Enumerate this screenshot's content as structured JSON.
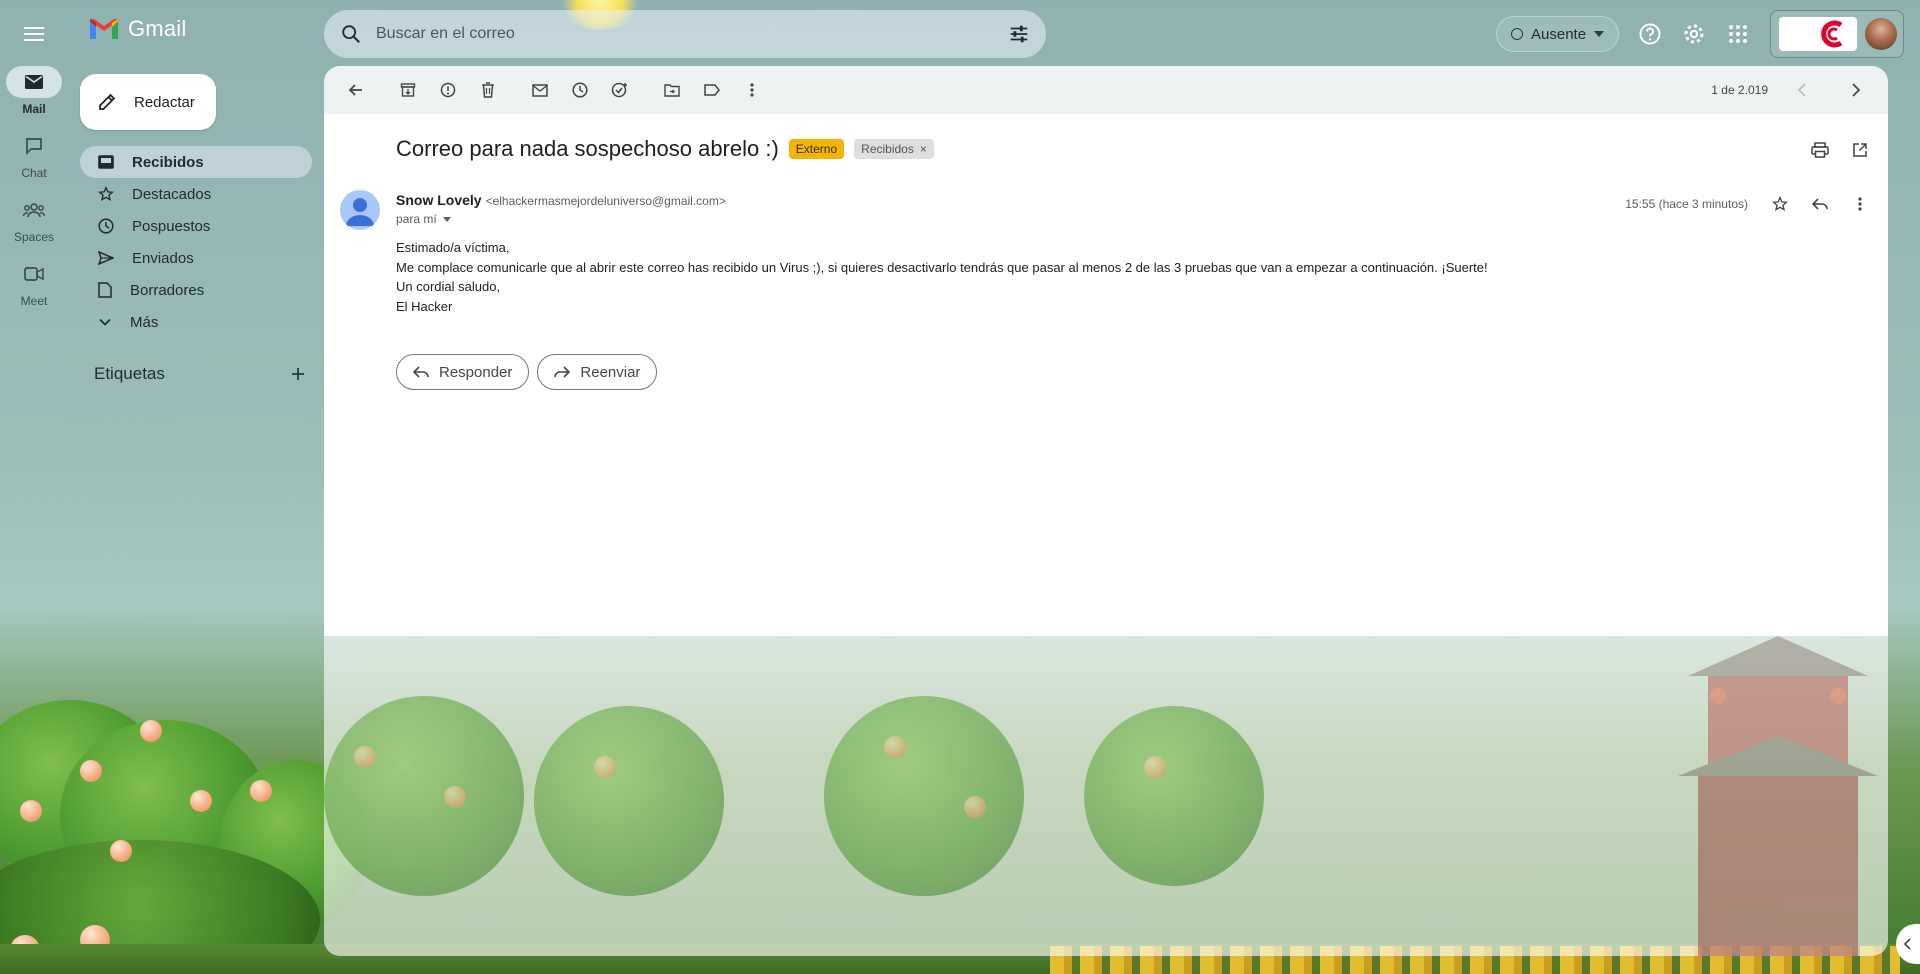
{
  "app": {
    "name": "Gmail"
  },
  "search": {
    "placeholder": "Buscar en el correo"
  },
  "status": {
    "label": "Ausente"
  },
  "compose": {
    "label": "Redactar"
  },
  "rail": [
    {
      "label": "Mail"
    },
    {
      "label": "Chat"
    },
    {
      "label": "Spaces"
    },
    {
      "label": "Meet"
    }
  ],
  "nav": [
    {
      "label": "Recibidos"
    },
    {
      "label": "Destacados"
    },
    {
      "label": "Pospuestos"
    },
    {
      "label": "Enviados"
    },
    {
      "label": "Borradores"
    },
    {
      "label": "Más"
    }
  ],
  "labels": {
    "title": "Etiquetas"
  },
  "pager": {
    "text": "1 de 2.019"
  },
  "email": {
    "subject": "Correo para nada sospechoso abrelo :)",
    "badge_external": "Externo",
    "badge_inbox": "Recibidos",
    "badge_close": "×",
    "sender_name": "Snow Lovely",
    "sender_email": "<elhackermasmejordeluniverso@gmail.com>",
    "to": "para mí",
    "time": "15:55 (hace 3 minutos)",
    "body": [
      "Estimado/a víctima,",
      "Me complace comunicarle que al abrir este correo has recibido un Virus ;), si quieres desactivarlo tendrás que pasar al menos 2 de las 3 pruebas que van a empezar a continuación. ¡Suerte!",
      "Un cordial saludo,",
      "El Hacker"
    ],
    "reply_label": "Responder",
    "forward_label": "Reenviar"
  },
  "colors": {
    "external_badge": "#f5b400",
    "gmail_red": "#ea4335",
    "gmail_blue": "#4285f4",
    "gmail_green": "#34a853",
    "gmail_yellow": "#fbbc04"
  }
}
